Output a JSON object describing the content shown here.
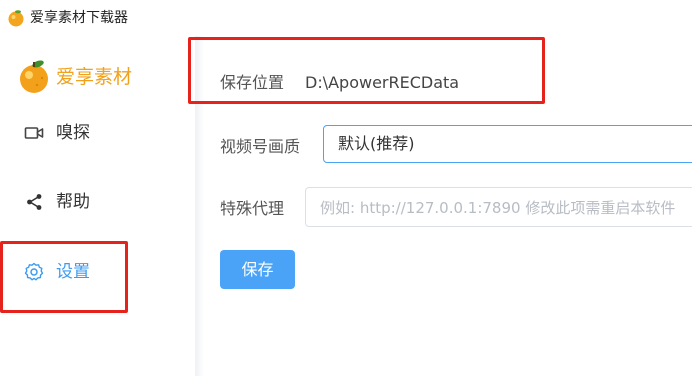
{
  "window": {
    "title": "爱享素材下载器",
    "icon": "orange-icon"
  },
  "sidebar": {
    "brand_name": "爱享素材",
    "brand_logo": "orange-logo",
    "brand_color": "#f0a21c",
    "items": [
      {
        "label": "嗅探",
        "icon": "video-camera-icon",
        "active": false
      },
      {
        "label": "帮助",
        "icon": "share-icon",
        "active": false
      },
      {
        "label": "设置",
        "icon": "gear-icon",
        "active": true
      }
    ]
  },
  "settings": {
    "save_path": {
      "label": "保存位置",
      "value": "D:\\ApowerRECData"
    },
    "video_quality": {
      "label": "视频号画质",
      "value": "默认(推荐)"
    },
    "proxy": {
      "label": "特殊代理",
      "placeholder": "例如: http://127.0.0.1:7890 修改此项需重启本软件"
    },
    "save_button": "保存"
  },
  "colors": {
    "accent": "#4aa3f7",
    "highlight": "#e5231c"
  }
}
